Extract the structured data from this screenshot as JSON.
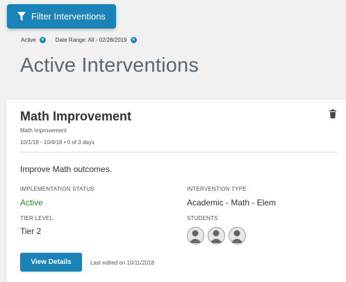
{
  "filter_button": {
    "label": "Filter Interventions",
    "icon": "filter-icon"
  },
  "active_filters": [
    {
      "label": "Active",
      "remove_icon": "close-circle-icon"
    },
    {
      "label": "Date Range: All - 02/28/2019",
      "remove_icon": "close-circle-icon"
    }
  ],
  "page": {
    "title": "Active Interventions"
  },
  "card": {
    "title": "Math Improvement",
    "subtitle": "Math Improvement",
    "dates": "10/1/18 - 10/4/18 • 0 of 3 days",
    "goal": "Improve Math outcomes.",
    "implementation_status": {
      "label": "IMPLEMENTATION STATUS",
      "value": "Active"
    },
    "intervention_type": {
      "label": "INTERVENTION TYPE",
      "value": "Academic - Math - Elem"
    },
    "tier_level": {
      "label": "TIER LEVEL",
      "value": "Tier 2"
    },
    "students": {
      "label": "STUDENTS",
      "count": 3,
      "icon": "user-avatar-icon"
    },
    "view_button": "View Details",
    "last_edited": "Last edited on 10/11/2018",
    "delete_icon": "trash-icon"
  },
  "colors": {
    "accent": "#1a84b8",
    "status_active": "#2e8b2e",
    "title": "#5a6870",
    "background": "#f1f1f1"
  }
}
